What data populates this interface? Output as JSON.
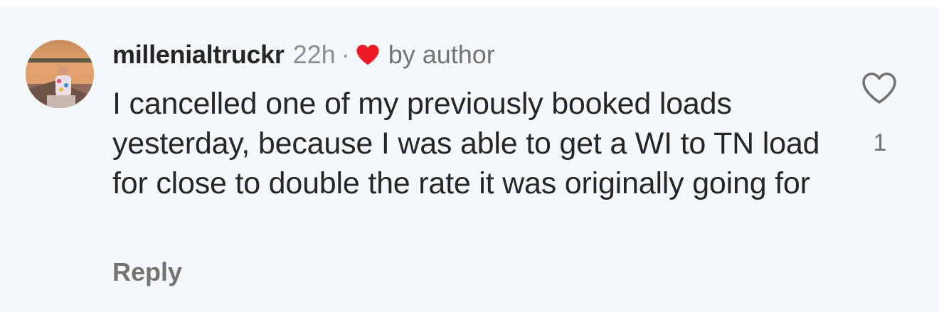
{
  "comment": {
    "username": "millenialtruckr",
    "timestamp": "22h",
    "separator": "·",
    "author_badge": "by author",
    "author_heart_color": "#ed1c24",
    "text": "I cancelled one of my previously booked loads yesterday, because I was able to get a WI to TN load for close to double the rate it was originally going for",
    "reply_label": "Reply",
    "like_icon": "heart-outline-icon",
    "like_count": "1"
  },
  "colors": {
    "background": "#f3f8fc",
    "primary_text": "#262626",
    "secondary_text": "#737373"
  }
}
